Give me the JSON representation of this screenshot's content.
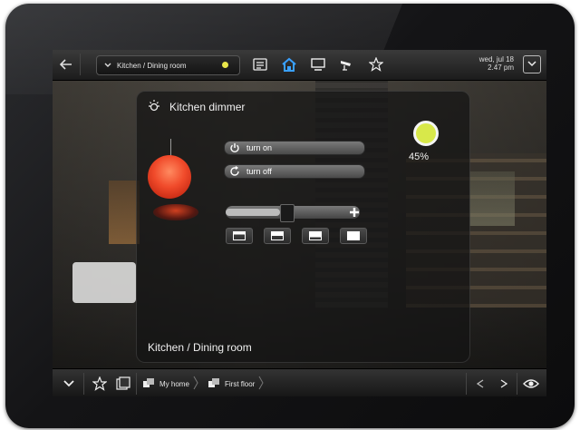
{
  "topbar": {
    "back_icon": "back-arrow-icon",
    "side_label": "",
    "breadcrumb": "Kitchen / Dining room",
    "status_color": "#e8e64a",
    "nav_icons": [
      "list-icon",
      "home-icon",
      "display-icon",
      "camera-icon",
      "star-icon"
    ],
    "date": "wed, jul 18",
    "time": "2.47 pm"
  },
  "panel": {
    "title": "Kitchen dimmer",
    "level": "45%",
    "level_value": 45,
    "turn_on_label": "turn on",
    "turn_off_label": "turn off",
    "footer": "Kitchen / Dining room",
    "lamp_color": "#f04a2a",
    "level_dot_color": "#d8e84a",
    "presets": [
      "preset-1",
      "preset-2",
      "preset-3",
      "preset-4"
    ]
  },
  "bottombar": {
    "crumbs": [
      "My home",
      "First floor"
    ]
  }
}
